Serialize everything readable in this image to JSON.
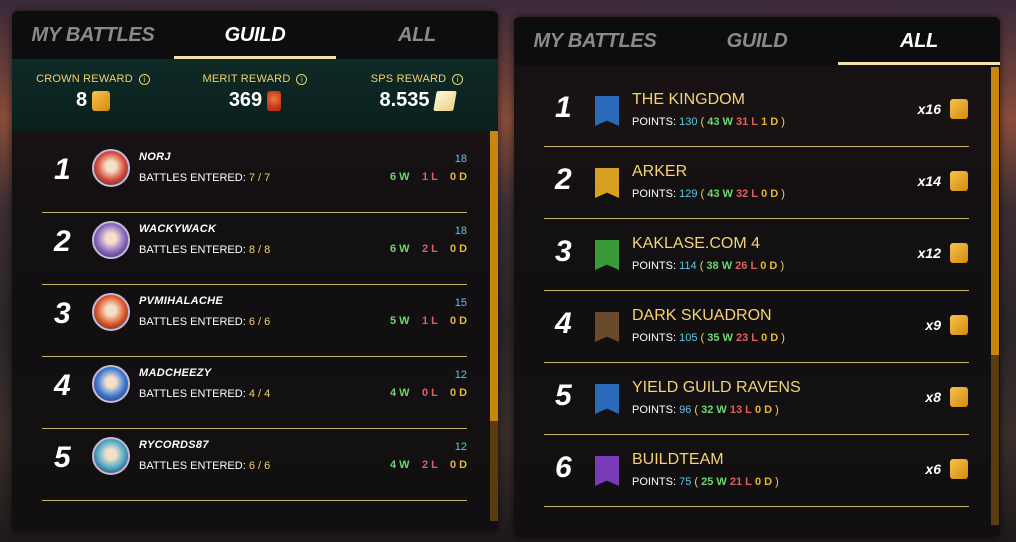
{
  "left": {
    "tabs": [
      {
        "label": "MY BATTLES",
        "active": false
      },
      {
        "label": "GUILD",
        "active": true
      },
      {
        "label": "ALL",
        "active": false
      }
    ],
    "rewards": [
      {
        "label": "CROWN REWARD",
        "value": "8",
        "icon": "crown-chip-icon"
      },
      {
        "label": "MERIT REWARD",
        "value": "369",
        "icon": "merit-icon"
      },
      {
        "label": "SPS REWARD",
        "value": "8.535",
        "icon": "sps-icon"
      }
    ],
    "players": [
      {
        "rank": "1",
        "name": "NORJ",
        "entered_label": "BATTLES ENTERED:",
        "entered": "7 / 7",
        "rating": "18",
        "w": "6 W",
        "l": "1 L",
        "d": "0 D",
        "avatar_color": "#d84a3a"
      },
      {
        "rank": "2",
        "name": "WACKYWACK",
        "entered_label": "BATTLES ENTERED:",
        "entered": "8 / 8",
        "rating": "18",
        "w": "6 W",
        "l": "2 L",
        "d": "0 D",
        "avatar_color": "#8a6ac8"
      },
      {
        "rank": "3",
        "name": "PVMIHALACHE",
        "entered_label": "BATTLES ENTERED:",
        "entered": "6 / 6",
        "rating": "15",
        "w": "5 W",
        "l": "1 L",
        "d": "0 D",
        "avatar_color": "#e0582a"
      },
      {
        "rank": "4",
        "name": "MADCHEEZY",
        "entered_label": "BATTLES ENTERED:",
        "entered": "4 / 4",
        "rating": "12",
        "w": "4 W",
        "l": "0 L",
        "d": "0 D",
        "avatar_color": "#3a7ad8"
      },
      {
        "rank": "5",
        "name": "RYCORDS87",
        "entered_label": "BATTLES ENTERED:",
        "entered": "6 / 6",
        "rating": "12",
        "w": "4 W",
        "l": "2 L",
        "d": "0 D",
        "avatar_color": "#4aa8c8"
      }
    ]
  },
  "right": {
    "tabs": [
      {
        "label": "MY BATTLES",
        "active": false
      },
      {
        "label": "GUILD",
        "active": false
      },
      {
        "label": "ALL",
        "active": true
      }
    ],
    "guilds": [
      {
        "rank": "1",
        "name": "THE KINGDOM",
        "points_label": "POINTS:",
        "points": "130",
        "w": "43 W",
        "l": "31 L",
        "d": "1 D",
        "mult": "x16",
        "banner_color": "#2a6ab8"
      },
      {
        "rank": "2",
        "name": "ARKER",
        "points_label": "POINTS:",
        "points": "129",
        "w": "43 W",
        "l": "32 L",
        "d": "0 D",
        "mult": "x14",
        "banner_color": "#d8a020"
      },
      {
        "rank": "3",
        "name": "KAKLASE.COM 4",
        "points_label": "POINTS:",
        "points": "114",
        "w": "38 W",
        "l": "26 L",
        "d": "0 D",
        "mult": "x12",
        "banner_color": "#3a9a3a"
      },
      {
        "rank": "4",
        "name": "DARK SKUADRON",
        "points_label": "POINTS:",
        "points": "105",
        "w": "35 W",
        "l": "23 L",
        "d": "0 D",
        "mult": "x9",
        "banner_color": "#6a4a2a"
      },
      {
        "rank": "5",
        "name": "YIELD GUILD RAVENS",
        "points_label": "POINTS:",
        "points": "96",
        "w": "32 W",
        "l": "13 L",
        "d": "0 D",
        "mult": "x8",
        "banner_color": "#2a6ab8"
      },
      {
        "rank": "6",
        "name": "BUILDTEAM",
        "points_label": "POINTS:",
        "points": "75",
        "w": "25 W",
        "l": "21 L",
        "d": "0 D",
        "mult": "x6",
        "banner_color": "#7a3ab8"
      }
    ]
  }
}
